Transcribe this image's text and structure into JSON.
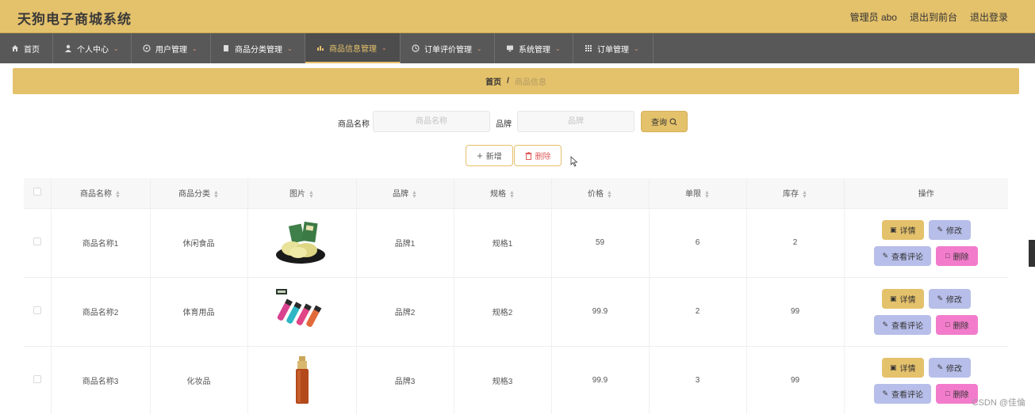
{
  "header": {
    "brand": "天狗电子商城系统",
    "admin": "管理员 abo",
    "front": "退出到前台",
    "logout": "退出登录",
    "bg_color": "#e4c16b"
  },
  "nav": {
    "items": [
      {
        "label": "首页",
        "icon": "home-icon"
      },
      {
        "label": "个人中心",
        "icon": "user-icon"
      },
      {
        "label": "用户管理",
        "icon": "circle-icon"
      },
      {
        "label": "商品分类管理",
        "icon": "doc-icon"
      },
      {
        "label": "商品信息管理",
        "icon": "chart-icon",
        "active": true
      },
      {
        "label": "订单评价管理",
        "icon": "clock-icon"
      },
      {
        "label": "系统管理",
        "icon": "monitor-icon"
      },
      {
        "label": "订单管理",
        "icon": "grid-icon"
      }
    ]
  },
  "breadcrumb": {
    "home": "首页",
    "sep": "/",
    "current": "商品信息"
  },
  "search": {
    "name_label": "商品名称",
    "name_placeholder": "商品名称",
    "brand_label": "品牌",
    "brand_placeholder": "品牌",
    "query_label": "查询"
  },
  "actions": {
    "add": "新增",
    "delete": "删除"
  },
  "table": {
    "columns": [
      "商品名称",
      "商品分类",
      "图片",
      "品牌",
      "规格",
      "价格",
      "单限",
      "库存",
      "操作"
    ],
    "rows": [
      {
        "name": "商品名称1",
        "category": "休闲食品",
        "image": "snack-image",
        "brand": "品牌1",
        "spec": "规格1",
        "price": "59",
        "limit": "6",
        "stock": "2"
      },
      {
        "name": "商品名称2",
        "category": "体育用品",
        "image": "sports-image",
        "brand": "品牌2",
        "spec": "规格2",
        "price": "99.9",
        "limit": "2",
        "stock": "99"
      },
      {
        "name": "商品名称3",
        "category": "化妆品",
        "image": "cosmetic-image",
        "brand": "品牌3",
        "spec": "规格3",
        "price": "99.9",
        "limit": "3",
        "stock": "99"
      }
    ],
    "ops": {
      "detail": "详情",
      "edit": "修改",
      "review": "查看评论",
      "delete": "删除"
    }
  },
  "watermark": "CSDN @佳倫"
}
